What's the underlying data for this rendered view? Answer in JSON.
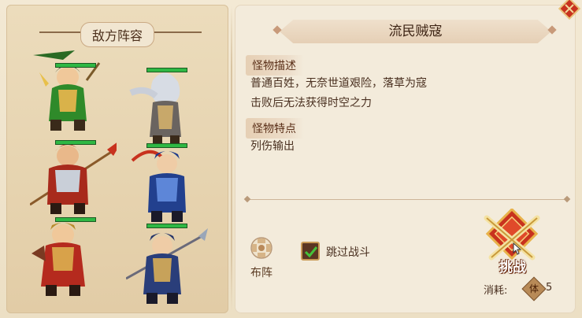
{
  "left_panel": {
    "title": "敌方阵容"
  },
  "enemy_name": "流民贼寇",
  "description": {
    "label": "怪物描述",
    "lines": [
      "普通百姓，无奈世道艰险，落草为寇",
      "击败后无法获得时空之力"
    ]
  },
  "traits": {
    "label": "怪物特点",
    "text": "列伤输出"
  },
  "formation_button": {
    "label": "布阵",
    "icon": "formation-icon"
  },
  "skip_battle": {
    "label": "跳过战斗",
    "checked": true
  },
  "challenge_button": {
    "label": "挑战"
  },
  "cost": {
    "label": "消耗:",
    "resource_icon_text": "体",
    "value": "5"
  },
  "heroes": [
    {
      "name": "green-general",
      "hp": 1.0
    },
    {
      "name": "white-haired-swordsman",
      "hp": 1.0
    },
    {
      "name": "red-armored-spearman",
      "hp": 1.0
    },
    {
      "name": "blue-armored-warrior",
      "hp": 1.0
    },
    {
      "name": "red-caped-brawler",
      "hp": 1.0
    },
    {
      "name": "blue-spear-soldier",
      "hp": 1.0
    }
  ],
  "colors": {
    "accent": "#c8321e",
    "hp_bar": "#2fb844",
    "panel_bg": "#f3ebdb"
  }
}
